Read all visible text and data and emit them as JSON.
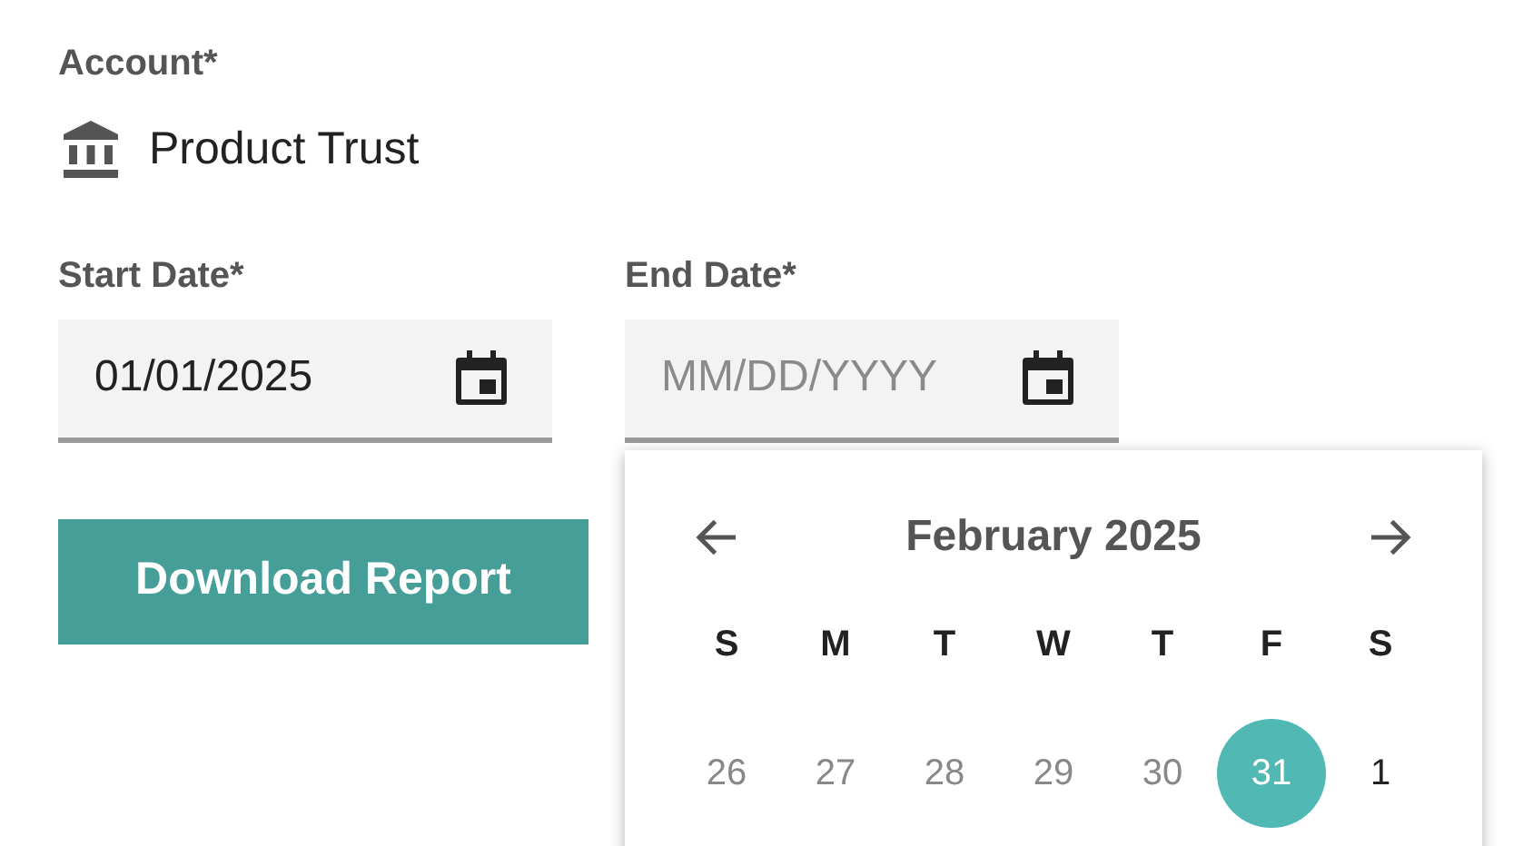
{
  "account": {
    "label": "Account*",
    "name": "Product Trust"
  },
  "start_date": {
    "label": "Start Date*",
    "value": "01/01/2025"
  },
  "end_date": {
    "label": "End Date*",
    "placeholder": "MM/DD/YYYY"
  },
  "download_button": "Download Report",
  "calendar": {
    "month": "February 2025",
    "weekdays": [
      "S",
      "M",
      "T",
      "W",
      "T",
      "F",
      "S"
    ],
    "days": [
      {
        "label": "26",
        "muted": true,
        "selected": false
      },
      {
        "label": "27",
        "muted": true,
        "selected": false
      },
      {
        "label": "28",
        "muted": true,
        "selected": false
      },
      {
        "label": "29",
        "muted": true,
        "selected": false
      },
      {
        "label": "30",
        "muted": true,
        "selected": false
      },
      {
        "label": "31",
        "muted": true,
        "selected": true
      },
      {
        "label": "1",
        "muted": false,
        "selected": false
      }
    ]
  }
}
